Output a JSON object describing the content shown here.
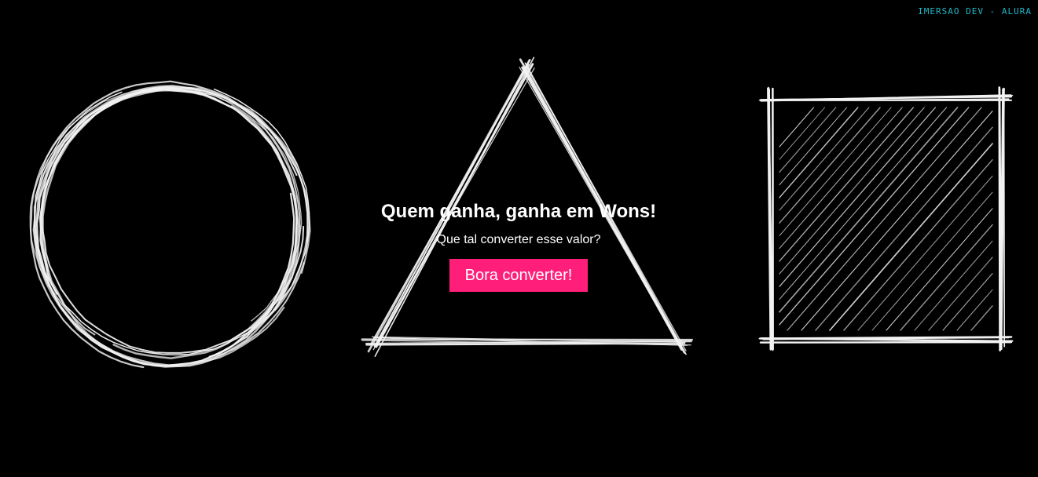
{
  "header": {
    "tag": "Imersao dev - Alura"
  },
  "hero": {
    "title": "Quem ganha, ganha em Wons!",
    "subtitle": "Que tal converter esse valor?",
    "button_label": "Bora converter!"
  },
  "colors": {
    "background": "#000000",
    "text": "#ffffff",
    "accent": "#ff1f7a",
    "tag": "#22b8c7",
    "sketch": "#f2f2f2"
  },
  "shapes": [
    "circle-icon",
    "triangle-icon",
    "square-icon"
  ]
}
